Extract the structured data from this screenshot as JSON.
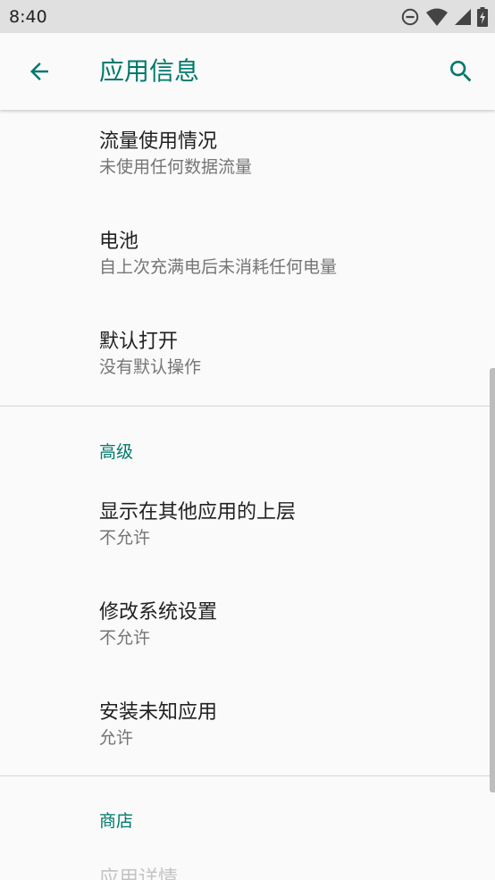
{
  "status_bar": {
    "time": "8:40"
  },
  "app_bar": {
    "title": "应用信息",
    "back_icon": "arrow-back-icon",
    "search_icon": "search-icon",
    "accent_color": "#00796b"
  },
  "general_items": [
    {
      "title": "流量使用情况",
      "summary": "未使用任何数据流量"
    },
    {
      "title": "电池",
      "summary": "自上次充满电后未消耗任何电量"
    },
    {
      "title": "默认打开",
      "summary": "没有默认操作"
    }
  ],
  "advanced": {
    "header": "高级",
    "items": [
      {
        "title": "显示在其他应用的上层",
        "summary": "不允许"
      },
      {
        "title": "修改系统设置",
        "summary": "不允许"
      },
      {
        "title": "安装未知应用",
        "summary": "允许"
      }
    ]
  },
  "store": {
    "header": "商店",
    "items": [
      {
        "title": "应用详情"
      }
    ]
  }
}
